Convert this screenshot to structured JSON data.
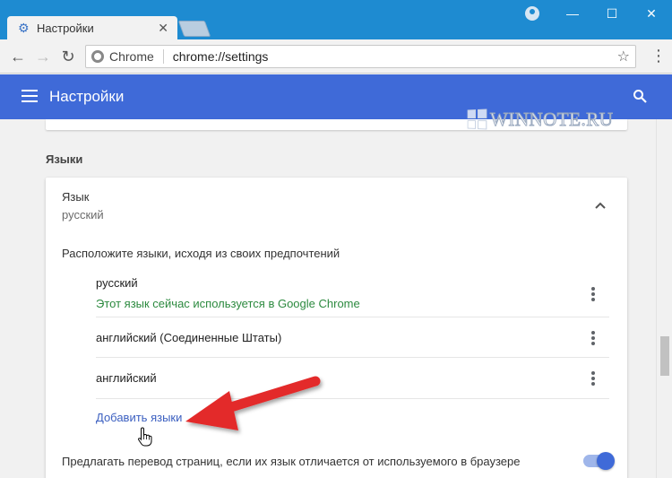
{
  "window": {
    "tab_title": "Настройки",
    "tab_close": "✕",
    "minimize": "—",
    "maximize": "☐",
    "close": "✕"
  },
  "toolbar": {
    "back": "←",
    "forward": "→",
    "reload": "↻",
    "omnibox_label": "Chrome",
    "url": "chrome://settings",
    "star": "☆",
    "menu": "⋮"
  },
  "header": {
    "title": "Настройки"
  },
  "watermark": {
    "text": "WINNOTE.RU"
  },
  "languages": {
    "section_title": "Языки",
    "lang_label": "Язык",
    "lang_value": "русский",
    "hint": "Расположите языки, исходя из своих предпочтений",
    "items": [
      {
        "name": "русский",
        "note": "Этот язык сейчас используется в Google Chrome"
      },
      {
        "name": "английский (Соединенные Штаты)"
      },
      {
        "name": "английский"
      }
    ],
    "add_link": "Добавить языки",
    "translate_text": "Предлагать перевод страниц, если их язык отличается от используемого в браузере",
    "translate_enabled": true
  },
  "colors": {
    "titlebar": "#1e8bd1",
    "header": "#3f6ad8",
    "link": "#3b5fc0",
    "note": "#2c8a3f",
    "arrow": "#e32b2b"
  }
}
